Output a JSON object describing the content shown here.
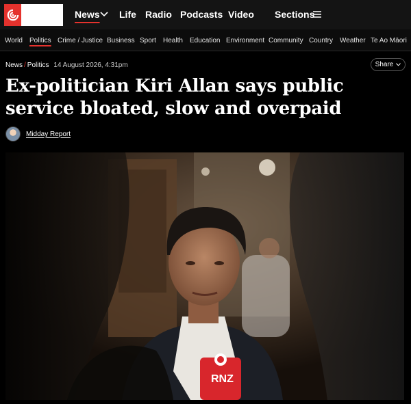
{
  "header": {
    "logo_alt": "RNZ",
    "nav": [
      "News",
      "Life",
      "Radio",
      "Podcasts",
      "Video"
    ],
    "sections_label": "Sections"
  },
  "secondary_nav": [
    "World",
    "Politics",
    "Crime / Justice",
    "Business",
    "Sport",
    "Health",
    "Education",
    "Environment",
    "Community",
    "Country",
    "Weather",
    "Te Ao Māori"
  ],
  "article": {
    "breadcrumb": [
      "News",
      "Politics"
    ],
    "date": "14 August 2026, 4:31pm",
    "share_label": "Share",
    "headline": "Ex-politician Kiri Allan says public service bloated, slow and overpaid",
    "author": "Midday Report"
  },
  "hero": {
    "mic_label": "RNZ"
  },
  "colors": {
    "brand_red": "#e5322d",
    "background": "#000000"
  }
}
